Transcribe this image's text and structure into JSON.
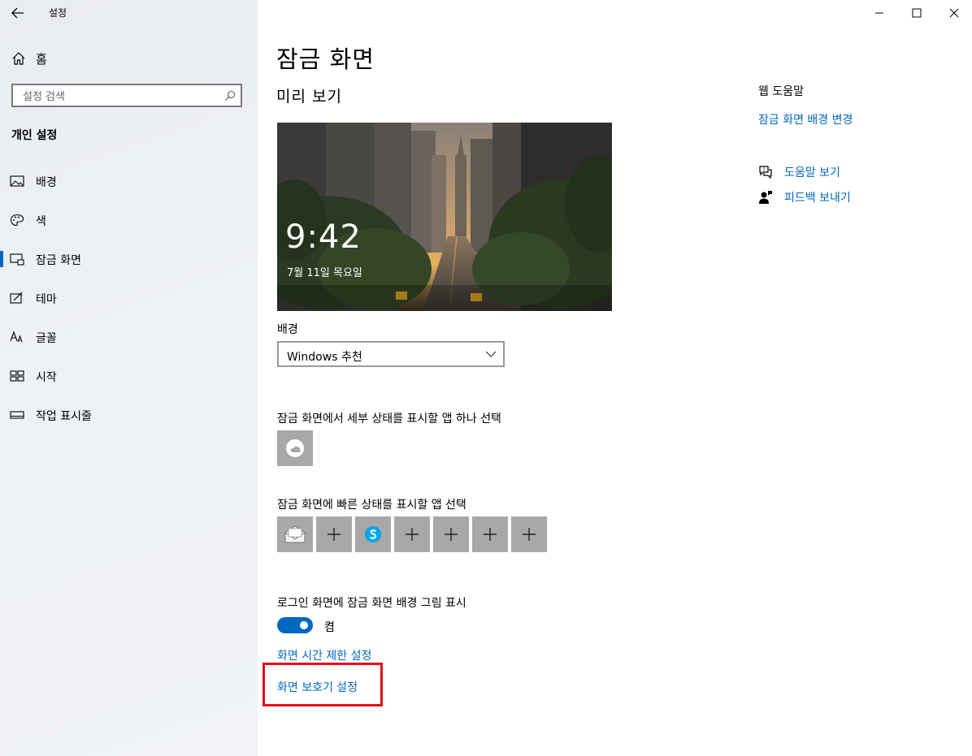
{
  "window": {
    "title": "설정",
    "controls": [
      "minimize",
      "maximize",
      "close"
    ]
  },
  "sidebar": {
    "home_label": "홈",
    "search_placeholder": "설정 검색",
    "section_title": "개인 설정",
    "items": [
      {
        "label": "배경",
        "icon": "picture-icon"
      },
      {
        "label": "색",
        "icon": "palette-icon"
      },
      {
        "label": "잠금 화면",
        "icon": "lock-screen-icon",
        "active": true
      },
      {
        "label": "테마",
        "icon": "theme-icon"
      },
      {
        "label": "글꼴",
        "icon": "font-icon"
      },
      {
        "label": "시작",
        "icon": "start-icon"
      },
      {
        "label": "작업 표시줄",
        "icon": "taskbar-icon"
      }
    ]
  },
  "main": {
    "page_title": "잠금 화면",
    "preview_heading": "미리 보기",
    "preview": {
      "time": "9:42",
      "date": "7월 11일 목요일"
    },
    "background_label": "배경",
    "background_value": "Windows 추천",
    "detail_status_label": "잠금 화면에서 세부 상태를 표시할 앱 하나 선택",
    "quick_status_label": "잠금 화면에 빠른 상태를 표시할 앱 선택",
    "quick_apps": [
      "mail-icon",
      "plus-icon",
      "skype-icon",
      "plus-icon",
      "plus-icon",
      "plus-icon",
      "plus-icon"
    ],
    "signin_label": "로그인 화면에 잠금 화면 배경 그림 표시",
    "toggle_state": "켬",
    "timeout_link": "화면 시간 제한 설정",
    "screensaver_link": "화면 보호기 설정"
  },
  "right_panel": {
    "web_help_heading": "웹 도움말",
    "change_bg_link": "잠금 화면 배경 변경",
    "help_link": "도움말 보기",
    "feedback_link": "피드백 보내기"
  },
  "colors": {
    "accent": "#0067c0",
    "highlight": "#e0101a",
    "tile": "#a8a8a8"
  }
}
